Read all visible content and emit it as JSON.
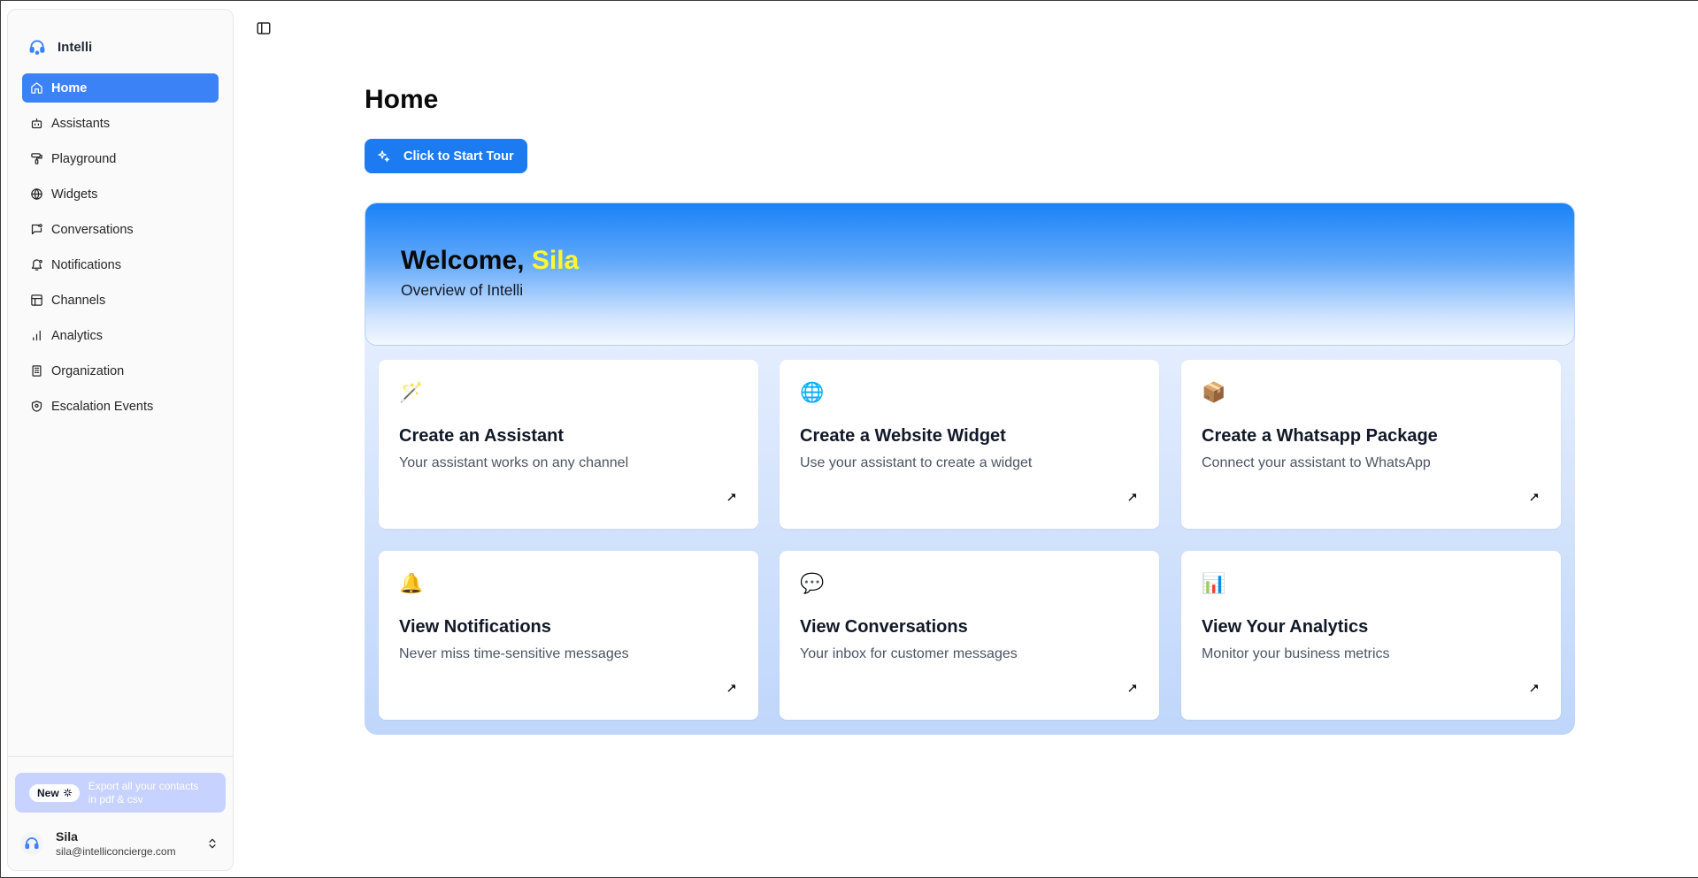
{
  "app": {
    "name": "Intelli"
  },
  "sidebar": {
    "items": [
      {
        "label": "Home",
        "icon": "home-icon",
        "active": true
      },
      {
        "label": "Assistants",
        "icon": "bot-icon"
      },
      {
        "label": "Playground",
        "icon": "paint-roller-icon"
      },
      {
        "label": "Widgets",
        "icon": "globe-icon"
      },
      {
        "label": "Conversations",
        "icon": "message-square-icon"
      },
      {
        "label": "Notifications",
        "icon": "bell-icon"
      },
      {
        "label": "Channels",
        "icon": "layout-icon"
      },
      {
        "label": "Analytics",
        "icon": "bar-chart-icon"
      },
      {
        "label": "Organization",
        "icon": "building-icon"
      },
      {
        "label": "Escalation Events",
        "icon": "shield-icon"
      }
    ],
    "promo": {
      "badge": "New",
      "text": "Export all your contacts in pdf & csv"
    },
    "user": {
      "name": "Sila",
      "email": "sila@intelliconcierge.com"
    }
  },
  "main": {
    "title": "Home",
    "tour_button": "Click to Start Tour",
    "welcome": {
      "greeting": "Welcome,",
      "name": "Sila",
      "subtitle": "Overview of Intelli"
    },
    "cards": [
      {
        "icon": "🪄",
        "title": "Create an Assistant",
        "desc": "Your assistant works on any channel"
      },
      {
        "icon": "🌐",
        "title": "Create a Website Widget",
        "desc": "Use your assistant to create a widget"
      },
      {
        "icon": "📦",
        "title": "Create a Whatsapp Package",
        "desc": "Connect your assistant to WhatsApp"
      },
      {
        "icon": "🔔",
        "title": "View Notifications",
        "desc": "Never miss time-sensitive messages"
      },
      {
        "icon": "💬",
        "title": "View Conversations",
        "desc": "Your inbox for customer messages"
      },
      {
        "icon": "📊",
        "title": "View Your Analytics",
        "desc": "Monitor your business metrics"
      }
    ]
  },
  "colors": {
    "accent": "#3b82f6",
    "button": "#1d7bf2",
    "highlight_name": "#fff82e"
  }
}
